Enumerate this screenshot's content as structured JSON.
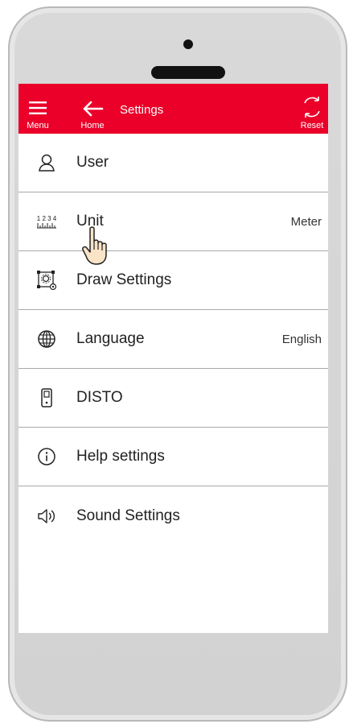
{
  "topbar": {
    "title": "Settings",
    "menu_label": "Menu",
    "home_label": "Home",
    "reset_label": "Reset",
    "bg_color": "#ea0029"
  },
  "settings": {
    "items": [
      {
        "label": "User",
        "value": "",
        "icon": "user-icon"
      },
      {
        "label": "Unit",
        "value": "Meter",
        "icon": "ruler-icon"
      },
      {
        "label": "Draw Settings",
        "value": "",
        "icon": "draw-settings-icon"
      },
      {
        "label": "Language",
        "value": "English",
        "icon": "globe-icon"
      },
      {
        "label": "DISTO",
        "value": "",
        "icon": "disto-device-icon"
      },
      {
        "label": "Help settings",
        "value": "",
        "icon": "info-icon"
      },
      {
        "label": "Sound Settings",
        "value": "",
        "icon": "speaker-icon"
      }
    ]
  },
  "unit_icon_text": "1 2 3 4"
}
